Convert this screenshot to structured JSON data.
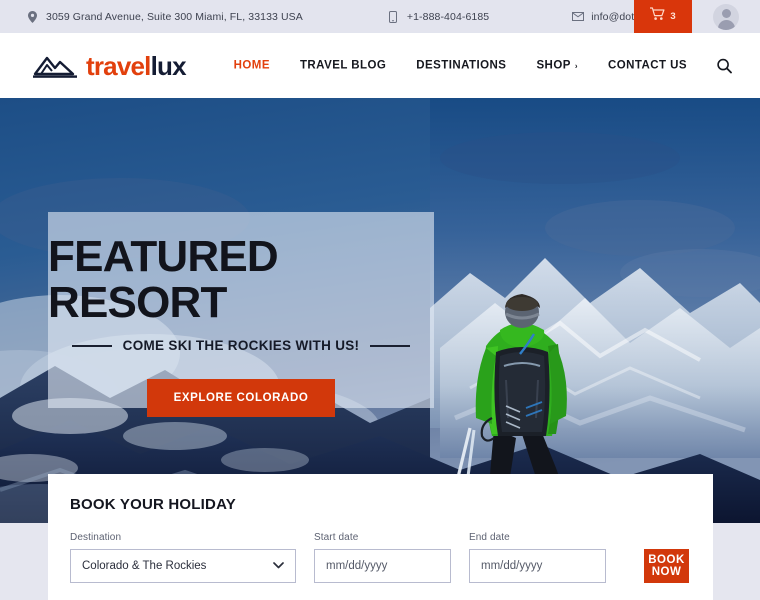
{
  "topbar": {
    "address": "3059 Grand Avenue, Suite 300 Miami, FL, 33133 USA",
    "address_icon": "location-pin-icon",
    "phone": "+1-888-404-6185",
    "phone_icon": "mobile-phone-icon",
    "email": "info@dotcms.com",
    "email_icon": "envelope-icon",
    "cart_icon": "shopping-cart-icon",
    "cart_count": "3",
    "account_icon": "user-avatar-icon",
    "background": "#e3e4ee",
    "cart_background": "#d9360b"
  },
  "header": {
    "logo": {
      "icon": "mountain-logo-icon",
      "text_first": "travel",
      "text_second": "lux",
      "color_first": "#e2400d",
      "color_second": "#141c33"
    },
    "nav": [
      {
        "label": "HOME",
        "active": true
      },
      {
        "label": "TRAVEL BLOG",
        "active": false
      },
      {
        "label": "DESTINATIONS",
        "active": false
      },
      {
        "label": "SHOP",
        "active": false,
        "caret": "›"
      },
      {
        "label": "CONTACT US",
        "active": false
      }
    ],
    "search_icon": "search-icon",
    "active_color": "#e2400d"
  },
  "hero": {
    "title": "FEATURED RESORT",
    "subtitle": "COME SKI THE ROCKIES WITH US!",
    "cta_label": "EXPLORE COLORADO",
    "cta_color": "#d2380b",
    "image_alt": "skier-on-mountain-summit-photo"
  },
  "booking": {
    "title": "BOOK YOUR HOLIDAY",
    "destination": {
      "label": "Destination",
      "value": "Colorado & The Rockies",
      "caret_icon": "chevron-down-icon"
    },
    "start_date": {
      "label": "Start date",
      "placeholder": "mm/dd/yyyy",
      "value": ""
    },
    "end_date": {
      "label": "End date",
      "placeholder": "mm/dd/yyyy",
      "value": ""
    },
    "submit_label": "BOOK NOW",
    "submit_color": "#d2380b"
  }
}
